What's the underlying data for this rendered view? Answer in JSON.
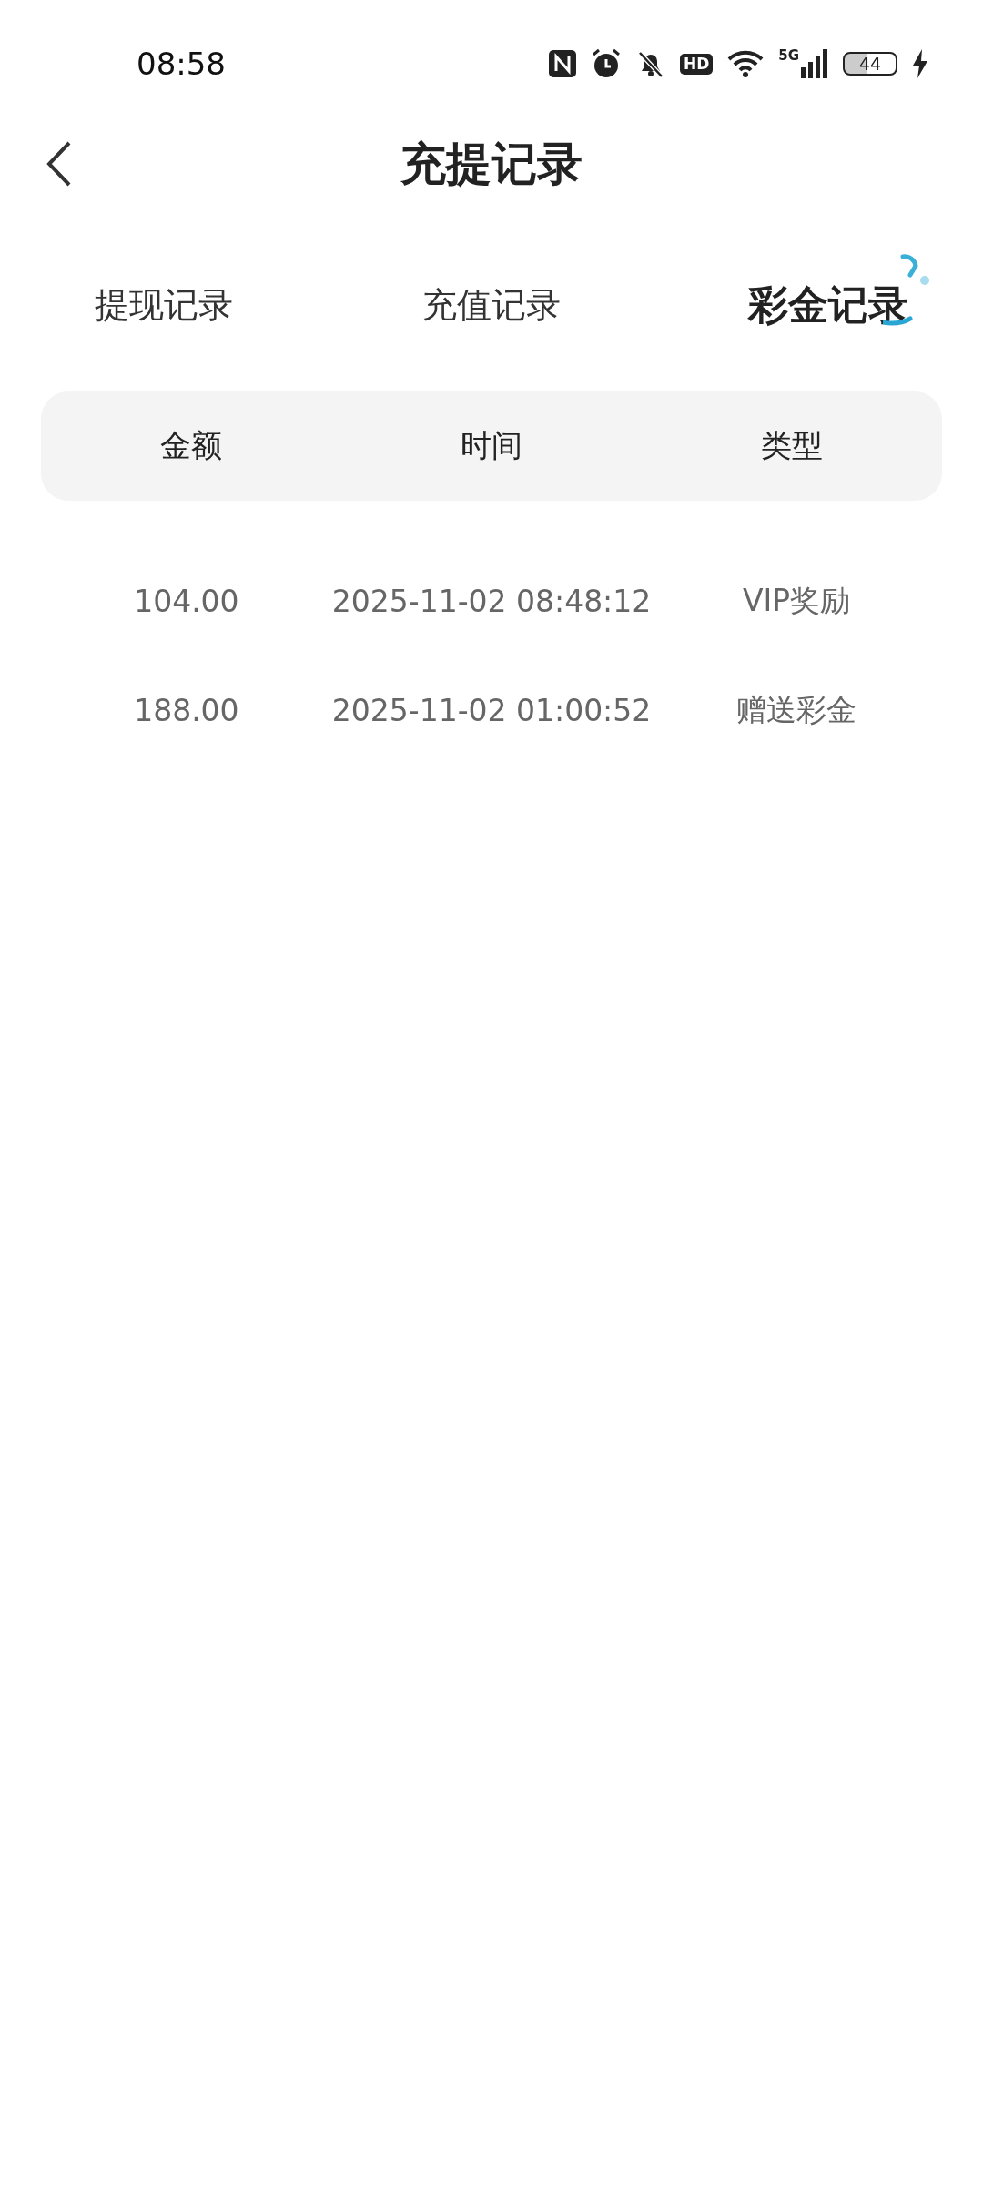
{
  "status_bar": {
    "time": "08:58",
    "network_label": "5G",
    "hd_label": "HD",
    "battery": "44"
  },
  "header": {
    "title": "充提记录"
  },
  "tabs": [
    {
      "label": "提现记录",
      "selected": false
    },
    {
      "label": "充值记录",
      "selected": false
    },
    {
      "label": "彩金记录",
      "selected": true
    }
  ],
  "table": {
    "columns": [
      "金额",
      "时间",
      "类型"
    ],
    "rows": [
      [
        "104.00",
        "2025-11-02 08:48:12",
        "VIP奖励"
      ],
      [
        "188.00",
        "2025-11-02 01:00:52",
        "赠送彩金"
      ]
    ]
  }
}
